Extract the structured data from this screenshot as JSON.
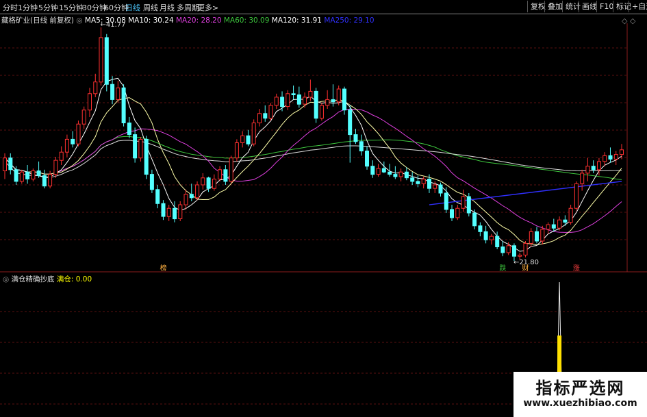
{
  "toolbar": {
    "periods": [
      "分时",
      "1分钟",
      "5分钟",
      "15分钟",
      "30分钟",
      "60分钟",
      "日线",
      "周线",
      "月线",
      "多周期",
      "更多>"
    ],
    "active_period": "日线",
    "right_buttons": [
      "复权",
      "叠加",
      "统计",
      "画线",
      "F10",
      "标记",
      "+自选"
    ]
  },
  "main_legend": {
    "stock_title": "藏格矿业(日线 前复权)",
    "ma": [
      {
        "label": "MA5: 30.08",
        "color": "#ffffff"
      },
      {
        "label": "MA10: 30.24",
        "color": "#ffffff"
      },
      {
        "label": "MA20: 28.20",
        "color": "#e040e0"
      },
      {
        "label": "MA60: 30.09",
        "color": "#3ec83e"
      },
      {
        "label": "MA120: 31.91",
        "color": "#ffffff"
      },
      {
        "label": "MA250: 29.10",
        "color": "#3030ff"
      }
    ]
  },
  "annotations": {
    "high_label": "41.77",
    "low_label": "21.80",
    "markers": [
      {
        "text": "榜",
        "color": "#ffb040"
      },
      {
        "text": "跌",
        "color": "#3ec83e"
      },
      {
        "text": "财",
        "color": "#ffb040"
      },
      {
        "text": "涨",
        "color": "#ff4040"
      }
    ]
  },
  "sub_legend": {
    "title": "满仓精确抄底",
    "value_label": "满仓:",
    "value": "0.00",
    "color": "#ffff00"
  },
  "watermark": {
    "line1": "指标严选网",
    "line2": "www.xuezhibiao.com"
  },
  "chart_data": {
    "type": "candlestick",
    "price_range": [
      21.8,
      41.77
    ],
    "ohlc": [
      [
        29.5,
        31.0,
        28.8,
        30.6
      ],
      [
        30.6,
        31.0,
        29.2,
        29.6
      ],
      [
        29.6,
        29.9,
        28.3,
        28.6
      ],
      [
        28.6,
        29.6,
        28.4,
        29.4
      ],
      [
        29.4,
        30.0,
        28.4,
        28.8
      ],
      [
        28.8,
        29.7,
        28.6,
        29.5
      ],
      [
        29.5,
        30.3,
        28.9,
        29.1
      ],
      [
        29.1,
        29.6,
        28.0,
        28.2
      ],
      [
        28.2,
        29.5,
        28.0,
        29.2
      ],
      [
        29.2,
        30.7,
        28.9,
        30.4
      ],
      [
        30.4,
        31.6,
        30.0,
        31.1
      ],
      [
        31.1,
        32.6,
        30.7,
        32.2
      ],
      [
        32.2,
        32.9,
        31.5,
        31.8
      ],
      [
        31.8,
        33.8,
        31.6,
        33.5
      ],
      [
        33.5,
        35.0,
        33.1,
        34.7
      ],
      [
        34.7,
        36.6,
        34.1,
        36.1
      ],
      [
        36.1,
        37.8,
        35.8,
        37.1
      ],
      [
        37.1,
        41.77,
        36.8,
        40.9
      ],
      [
        40.9,
        41.2,
        36.3,
        36.9
      ],
      [
        36.9,
        37.6,
        35.2,
        35.6
      ],
      [
        35.6,
        37.2,
        35.3,
        36.6
      ],
      [
        36.6,
        36.9,
        33.3,
        33.6
      ],
      [
        33.6,
        34.1,
        32.3,
        32.6
      ],
      [
        32.6,
        33.2,
        30.2,
        30.6
      ],
      [
        30.6,
        32.4,
        30.3,
        32.2
      ],
      [
        32.2,
        32.5,
        28.8,
        29.2
      ],
      [
        29.2,
        29.6,
        27.6,
        27.9
      ],
      [
        27.9,
        28.3,
        26.3,
        26.7
      ],
      [
        26.7,
        27.0,
        25.3,
        25.6
      ],
      [
        25.6,
        26.6,
        25.2,
        26.3
      ],
      [
        26.3,
        26.9,
        25.1,
        25.4
      ],
      [
        25.4,
        26.9,
        25.2,
        26.6
      ],
      [
        26.6,
        27.9,
        26.2,
        27.5
      ],
      [
        27.5,
        28.4,
        26.9,
        27.2
      ],
      [
        27.2,
        28.6,
        27.0,
        28.3
      ],
      [
        28.3,
        29.3,
        27.9,
        28.9
      ],
      [
        28.9,
        29.0,
        27.7,
        28.0
      ],
      [
        28.0,
        29.2,
        27.8,
        28.8
      ],
      [
        28.8,
        29.9,
        28.6,
        29.6
      ],
      [
        29.6,
        30.0,
        28.3,
        28.6
      ],
      [
        28.6,
        30.8,
        28.4,
        30.6
      ],
      [
        30.6,
        32.2,
        30.3,
        31.9
      ],
      [
        31.9,
        32.9,
        31.5,
        32.5
      ],
      [
        32.5,
        33.0,
        31.6,
        31.8
      ],
      [
        31.8,
        33.9,
        31.6,
        33.6
      ],
      [
        33.6,
        34.8,
        33.3,
        34.4
      ],
      [
        34.4,
        35.1,
        33.7,
        34.0
      ],
      [
        34.0,
        35.3,
        33.8,
        35.1
      ],
      [
        35.1,
        36.1,
        34.8,
        35.8
      ],
      [
        35.8,
        36.3,
        34.6,
        35.0
      ],
      [
        35.0,
        36.4,
        34.7,
        36.1
      ],
      [
        36.1,
        36.8,
        35.6,
        36.0
      ],
      [
        36.0,
        36.7,
        34.9,
        35.2
      ],
      [
        35.2,
        36.2,
        34.9,
        35.8
      ],
      [
        35.8,
        37.3,
        35.5,
        36.3
      ],
      [
        36.3,
        36.6,
        33.6,
        34.0
      ],
      [
        34.0,
        35.3,
        33.8,
        35.1
      ],
      [
        35.1,
        36.4,
        34.8,
        35.6
      ],
      [
        35.6,
        36.9,
        35.0,
        35.4
      ],
      [
        35.4,
        36.8,
        35.1,
        36.5
      ],
      [
        36.5,
        36.7,
        34.3,
        34.7
      ],
      [
        34.7,
        35.1,
        30.2,
        32.6
      ],
      [
        32.6,
        33.1,
        31.8,
        32.0
      ],
      [
        32.0,
        32.6,
        30.8,
        31.2
      ],
      [
        31.2,
        31.6,
        29.6,
        29.9
      ],
      [
        29.9,
        30.4,
        28.9,
        29.2
      ],
      [
        29.2,
        30.1,
        29.0,
        29.7
      ],
      [
        29.7,
        30.3,
        29.3,
        29.4
      ],
      [
        29.4,
        30.1,
        29.0,
        29.2
      ],
      [
        29.2,
        29.9,
        28.8,
        29.0
      ],
      [
        29.0,
        29.7,
        28.6,
        29.4
      ],
      [
        29.4,
        29.8,
        28.7,
        28.9
      ],
      [
        28.9,
        29.4,
        28.3,
        28.6
      ],
      [
        28.6,
        29.1,
        28.1,
        28.4
      ],
      [
        28.4,
        29.0,
        28.0,
        28.8
      ],
      [
        28.8,
        29.2,
        27.6,
        28.0
      ],
      [
        28.0,
        28.6,
        27.6,
        28.3
      ],
      [
        28.3,
        28.5,
        27.3,
        27.6
      ],
      [
        27.6,
        28.1,
        25.9,
        26.2
      ],
      [
        26.2,
        26.6,
        25.2,
        25.5
      ],
      [
        25.5,
        26.6,
        25.3,
        26.3
      ],
      [
        26.3,
        27.9,
        26.0,
        27.3
      ],
      [
        27.3,
        27.6,
        25.6,
        25.9
      ],
      [
        25.9,
        26.2,
        24.5,
        24.8
      ],
      [
        24.8,
        25.1,
        23.9,
        24.3
      ],
      [
        24.3,
        24.8,
        23.3,
        23.6
      ],
      [
        23.6,
        24.1,
        23.2,
        23.9
      ],
      [
        23.9,
        24.3,
        22.8,
        23.0
      ],
      [
        23.0,
        23.5,
        22.2,
        22.5
      ],
      [
        22.5,
        23.4,
        22.3,
        23.1
      ],
      [
        23.1,
        23.3,
        21.8,
        22.2
      ],
      [
        22.2,
        22.5,
        21.9,
        22.3
      ],
      [
        22.3,
        23.5,
        22.1,
        23.3
      ],
      [
        23.3,
        24.6,
        23.0,
        24.3
      ],
      [
        24.3,
        24.7,
        23.3,
        23.5
      ],
      [
        23.5,
        24.8,
        23.2,
        24.5
      ],
      [
        24.5,
        25.1,
        24.1,
        24.9
      ],
      [
        24.9,
        25.4,
        24.3,
        24.6
      ],
      [
        24.6,
        25.6,
        24.4,
        25.3
      ],
      [
        25.3,
        25.7,
        24.8,
        25.1
      ],
      [
        25.1,
        26.6,
        24.9,
        26.3
      ],
      [
        26.3,
        28.6,
        26.1,
        28.4
      ],
      [
        28.4,
        29.6,
        27.8,
        29.3
      ],
      [
        29.3,
        30.6,
        28.6,
        29.9
      ],
      [
        29.9,
        30.4,
        29.3,
        29.6
      ],
      [
        29.6,
        30.6,
        29.1,
        30.3
      ],
      [
        30.3,
        31.1,
        29.9,
        30.8
      ],
      [
        30.8,
        31.5,
        30.2,
        30.5
      ],
      [
        30.5,
        31.2,
        30.0,
        30.9
      ],
      [
        30.9,
        31.8,
        30.5,
        31.3
      ]
    ],
    "sub_indicator": {
      "name": "满仓",
      "spike_index": 98,
      "value": 0.0
    }
  }
}
